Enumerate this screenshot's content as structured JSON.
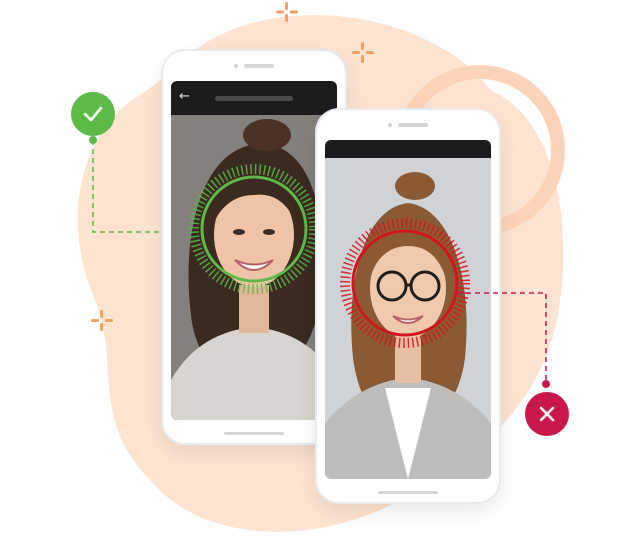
{
  "colors": {
    "accent_green": "#5cba47",
    "accent_red": "#c9174b",
    "blob_peach": "#fde3d0",
    "sparkle_orange": "#f5a05a"
  },
  "icons": {
    "approved": "check-icon",
    "rejected": "close-icon",
    "back": "back-arrow-icon"
  },
  "phone_1": {
    "back_glyph": "←",
    "status": "face-match-approved"
  },
  "phone_2": {
    "status": "face-match-rejected"
  }
}
